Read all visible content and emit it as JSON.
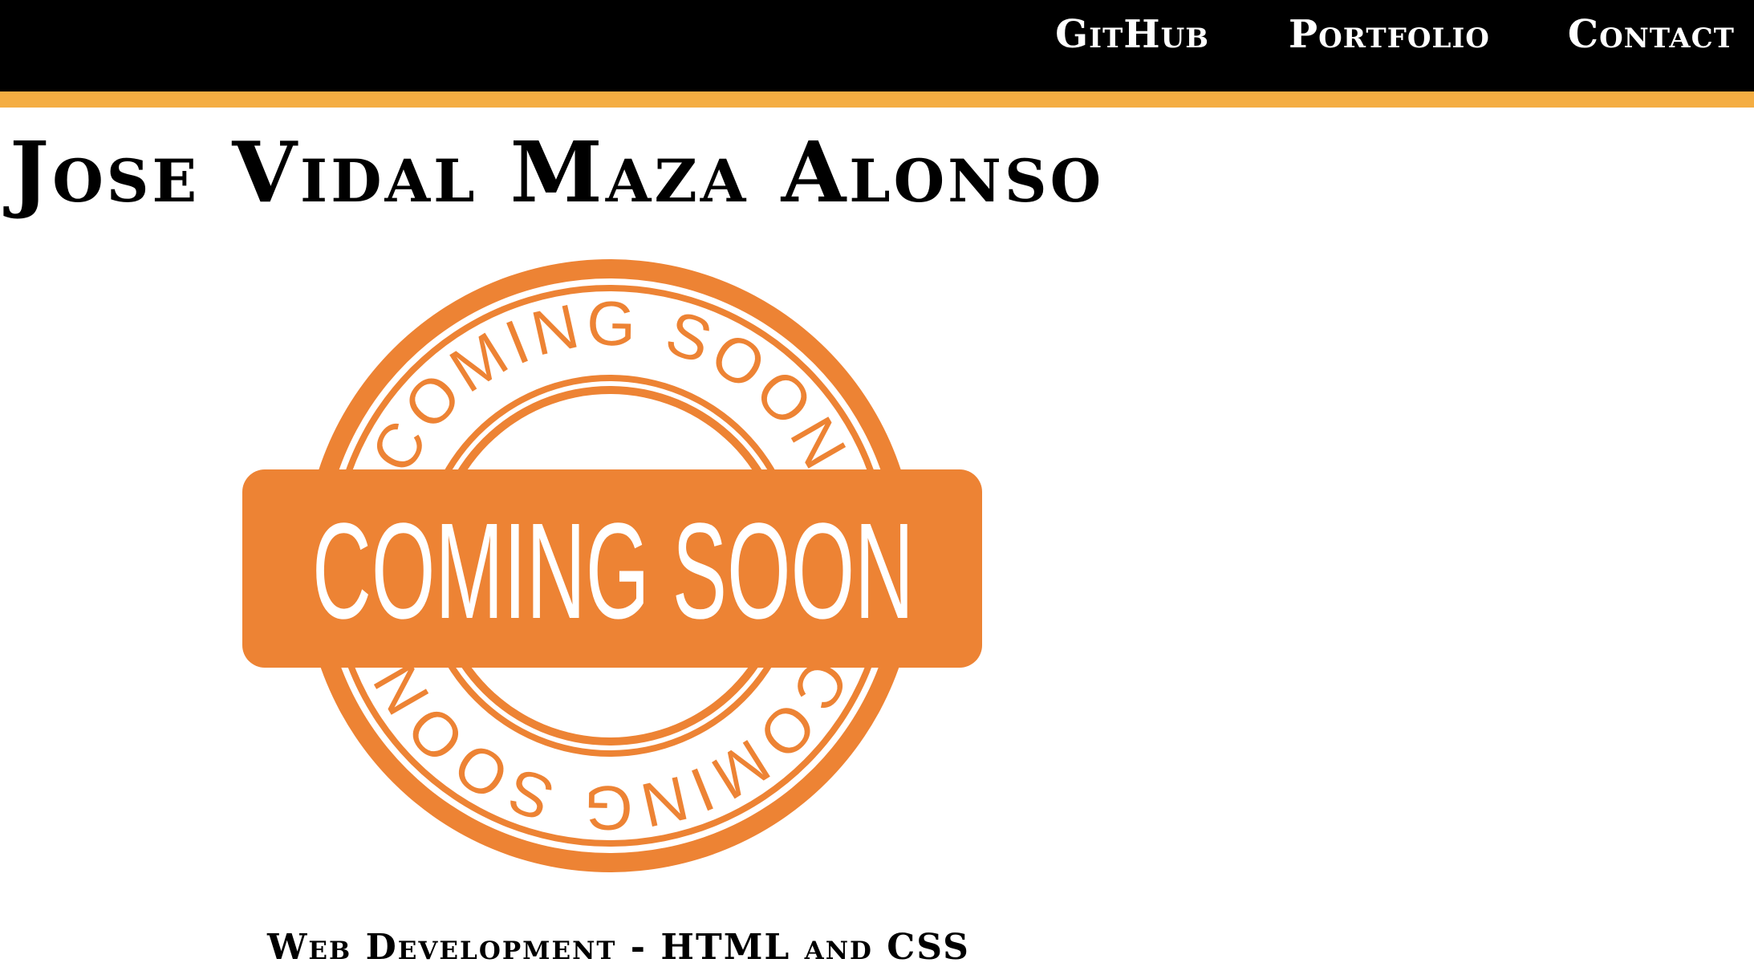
{
  "nav": {
    "items": [
      {
        "label": "GitHub"
      },
      {
        "label": "Portfolio"
      },
      {
        "label": "Contact"
      }
    ]
  },
  "header": {
    "title": "Jose Vidal Maza Alonso"
  },
  "project": {
    "badge_text": "COMING SOON",
    "badge_ring_text": "COMING SOON",
    "caption": "Web Development - HTML and CSS"
  },
  "colors": {
    "topbar": "#000000",
    "accent": "#f4ad42",
    "badge": "#ed8334"
  }
}
